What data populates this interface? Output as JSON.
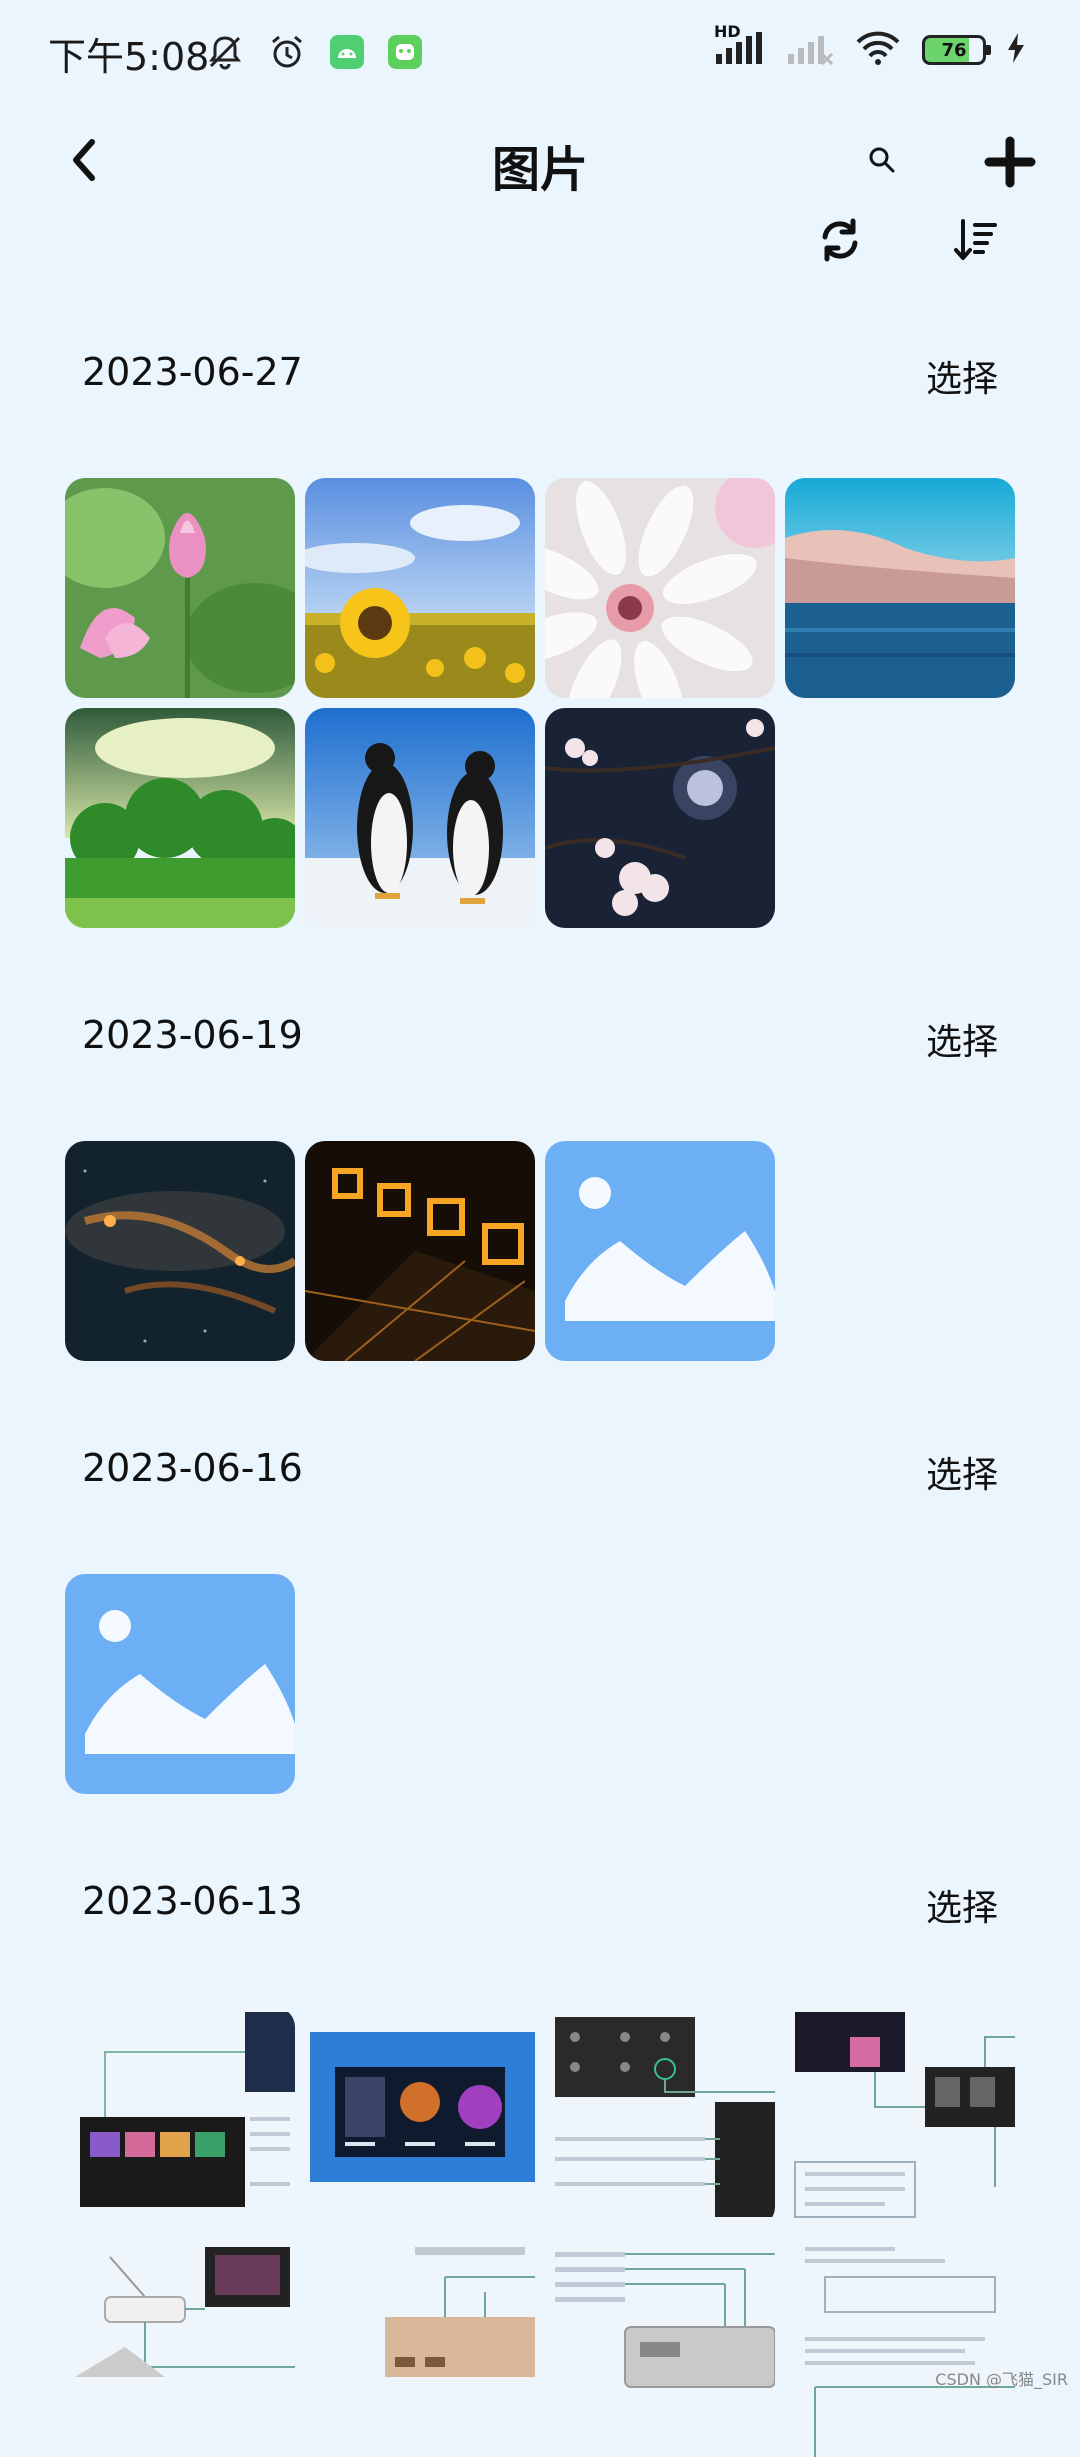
{
  "status_bar": {
    "time": "下午5:08",
    "hd": "HD",
    "battery_level": "76",
    "battery_fraction": 0.76
  },
  "nav": {
    "title": "图片",
    "back_icon": "chevron-left-icon",
    "search_icon": "search-icon",
    "add_icon": "plus-icon"
  },
  "toolbar": {
    "refresh_icon": "refresh-icon",
    "sort_icon": "sort-icon"
  },
  "sections": [
    {
      "date": "2023-06-27",
      "select_label": "选择",
      "photos": [
        "lotus",
        "sunflower",
        "daisy",
        "ocean",
        "trees",
        "penguins",
        "blossom-moon"
      ]
    },
    {
      "date": "2023-06-19",
      "select_label": "选择",
      "photos": [
        "nebula",
        "light-cubes",
        "placeholder"
      ]
    },
    {
      "date": "2023-06-16",
      "select_label": "选择",
      "photos": [
        "placeholder"
      ]
    },
    {
      "date": "2023-06-13",
      "select_label": "选择",
      "photos": [
        "diagram",
        "diagram",
        "diagram",
        "diagram",
        "diagram",
        "diagram",
        "diagram",
        "diagram"
      ]
    }
  ],
  "watermark": "CSDN @飞猫_SIR"
}
